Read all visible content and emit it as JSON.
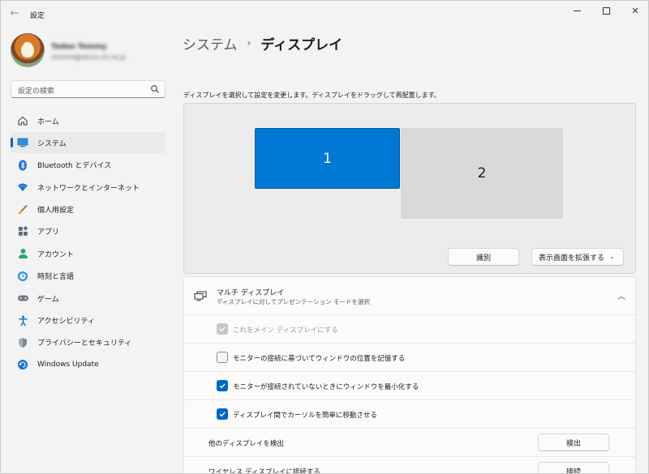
{
  "window": {
    "title": "設定",
    "back_glyph": "←",
    "minimize_glyph": "—",
    "close_glyph": "✕"
  },
  "profile": {
    "name": "Tadao Tommy",
    "email": "xtommi@xenux.nh.ne.jp"
  },
  "search": {
    "placeholder": "設定の検索"
  },
  "sidebar": {
    "items": [
      {
        "label": "ホーム",
        "icon": "home-icon"
      },
      {
        "label": "システム",
        "icon": "system-icon",
        "selected": true
      },
      {
        "label": "Bluetooth とデバイス",
        "icon": "bluetooth-icon"
      },
      {
        "label": "ネットワークとインターネット",
        "icon": "wifi-icon"
      },
      {
        "label": "個人用設定",
        "icon": "brush-icon"
      },
      {
        "label": "アプリ",
        "icon": "apps-icon"
      },
      {
        "label": "アカウント",
        "icon": "account-icon"
      },
      {
        "label": "時刻と言語",
        "icon": "time-language-icon"
      },
      {
        "label": "ゲーム",
        "icon": "gamepad-icon"
      },
      {
        "label": "アクセシビリティ",
        "icon": "accessibility-icon"
      },
      {
        "label": "プライバシーとセキュリティ",
        "icon": "shield-icon"
      },
      {
        "label": "Windows Update",
        "icon": "update-icon"
      }
    ]
  },
  "main": {
    "breadcrumb_parent": "システム",
    "breadcrumb_sep": "›",
    "breadcrumb_current": "ディスプレイ",
    "instruction": "ディスプレイを選択して設定を変更します。ディスプレイをドラッグして再配置します。",
    "monitors": [
      "1",
      "2"
    ],
    "identify_label": "識別",
    "extend_label": "表示画面を拡張する",
    "extend_chevron": "⌄",
    "multi": {
      "title": "マルチ ディスプレイ",
      "subtitle": "ディスプレイに対してプレゼンテーション モードを選択",
      "chevron": "︿",
      "options": [
        {
          "label": "これをメイン ディスプレイにする",
          "checked": true,
          "disabled": true
        },
        {
          "label": "モニターの接続に基づいてウィンドウの位置を記憶する",
          "checked": false,
          "disabled": false
        },
        {
          "label": "モニターが接続されていないときにウィンドウを最小化する",
          "checked": true,
          "disabled": false
        },
        {
          "label": "ディスプレイ間でカーソルを簡単に移動させる",
          "checked": true,
          "disabled": false
        }
      ],
      "detect_label": "他のディスプレイを検出",
      "detect_button": "検出",
      "wireless_label": "ワイヤレス ディスプレイに接続する",
      "wireless_button": "接続"
    }
  },
  "colors": {
    "accent": "#0067c0",
    "monitor_selected": "#0078d4",
    "monitor_other": "#d9d9d9"
  }
}
